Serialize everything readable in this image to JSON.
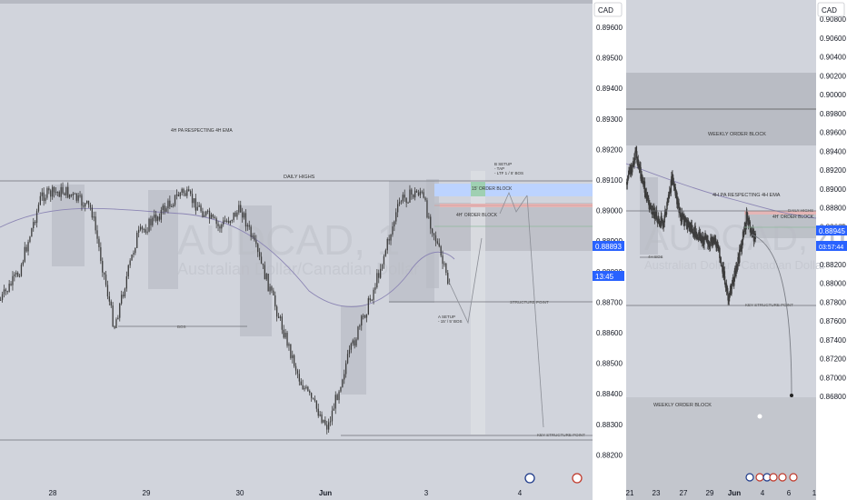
{
  "currency": "CAD",
  "watermark": {
    "symbol": "AUDCAD, 1",
    "subtitle": "Australian Dollar/Canadian Dollar",
    "symbol_right": "AUDCAD, 4h",
    "subtitle_right": "Australian Dollar / Canadian Dollar"
  },
  "colors": {
    "background": "#d1d4dc",
    "candle": "#3d3d3d",
    "ema": "#8c86b4",
    "blue_zone": "#bcd3ff",
    "green_zone": "#9fd0b2",
    "red_zone": "#e5b6b6",
    "price_badge": "#2962ff",
    "level_line": "#6e7077"
  },
  "chart_data": [
    {
      "type": "candlestick",
      "timeframe": "15m",
      "x_ticks": [
        "28",
        "29",
        "30",
        "Jun",
        "3",
        "4"
      ],
      "y_ticks": [
        "0.89600",
        "0.89500",
        "0.89400",
        "0.89300",
        "0.89200",
        "0.89100",
        "0.89000",
        "0.88900",
        "0.88800",
        "0.88700",
        "0.88600",
        "0.88500",
        "0.88400",
        "0.88300",
        "0.88200"
      ],
      "ylim": [
        0.8817,
        0.8975
      ],
      "current_price": "0.88893",
      "countdown": "13:45",
      "annotations": [
        "4H PA RESPECTING 4H EMA",
        "DAILY HIGHS",
        "B SETUP",
        "- TAP",
        "- LTF 1 / 5' BOS",
        "15' ORDER BLOCK",
        "4H' ORDER BLOCK",
        "STRUCTURE POINT",
        "A SETUP",
        "- 15' / 5' BOS",
        "BOS",
        "KEY STRUCTURE POINT"
      ]
    },
    {
      "type": "candlestick",
      "timeframe": "4h",
      "x_ticks": [
        "21",
        "23",
        "27",
        "29",
        "Jun",
        "4",
        "6",
        "1"
      ],
      "y_ticks": [
        "0.90800",
        "0.90600",
        "0.90400",
        "0.90200",
        "0.90000",
        "0.89800",
        "0.89600",
        "0.89400",
        "0.89200",
        "0.89000",
        "0.88800",
        "0.88600",
        "0.88400",
        "0.88200",
        "0.88000",
        "0.87800",
        "0.87600",
        "0.87400",
        "0.87200",
        "0.87000",
        "0.86800"
      ],
      "ylim": [
        0.8667,
        0.9093
      ],
      "current_price": "0.88945",
      "countdown": "03:57:44",
      "annotations": [
        "WEEKLY ORDER BLOCK",
        "4H PA RESPECTING 4H EMA",
        "DAILY HIGHS",
        "4H' ORDER BLOCK",
        "4H BOS",
        "KEY STRUCTURE POINT",
        "WEEKLY ORDER BLOCK"
      ]
    }
  ]
}
